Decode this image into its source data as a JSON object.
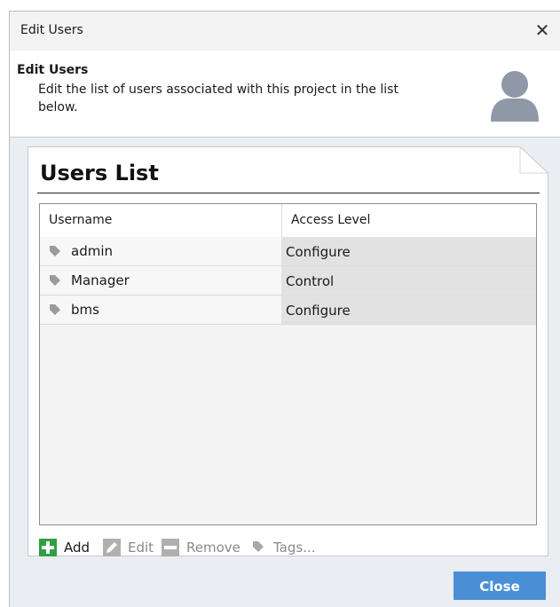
{
  "window": {
    "title": "Edit Users",
    "close_glyph": "✕"
  },
  "header": {
    "title": "Edit Users",
    "description": "Edit the list of users associated with this project in the list below.",
    "icon": "user-silhouette-icon"
  },
  "card": {
    "heading": "Users List"
  },
  "table": {
    "columns": [
      "Username",
      "Access Level"
    ],
    "rows": [
      {
        "username": "admin",
        "access_level": "Configure"
      },
      {
        "username": "Manager",
        "access_level": "Control"
      },
      {
        "username": "bms",
        "access_level": "Configure"
      }
    ]
  },
  "toolbar": {
    "add_label": "Add",
    "edit_label": "Edit",
    "remove_label": "Remove",
    "tags_label": "Tags..."
  },
  "footer": {
    "close_label": "Close"
  },
  "colors": {
    "accent": "#4a8fd6",
    "add_green": "#2ea043",
    "disabled_gray": "#a8a8a8",
    "tag_gray": "#9a9a9a"
  }
}
